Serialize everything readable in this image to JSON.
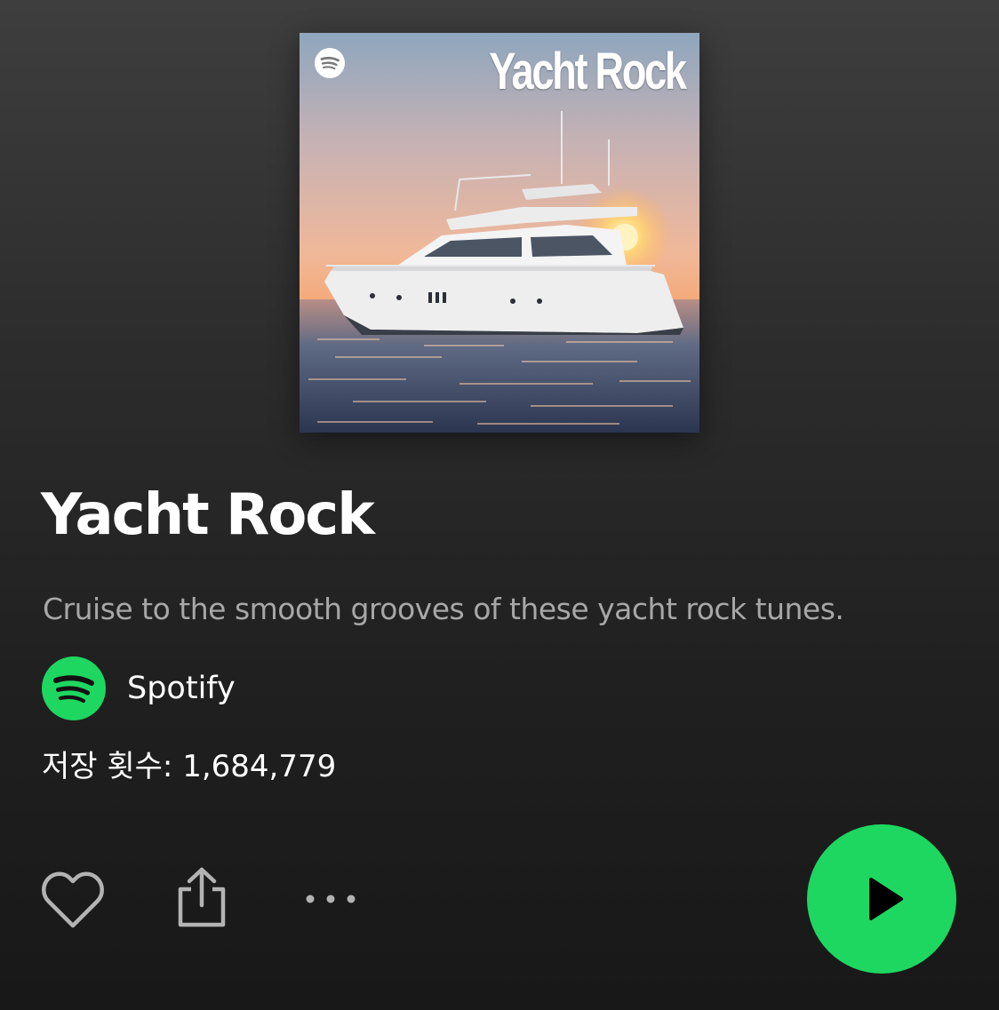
{
  "playlist": {
    "cover": {
      "overlay_title": "Yacht Rock",
      "brand_icon": "spotify-logo-icon",
      "image_subject": "yacht-at-sunset-photo"
    },
    "title": "Yacht Rock",
    "description": "Cruise to the smooth grooves of these yacht rock tunes.",
    "owner": {
      "name": "Spotify",
      "avatar_icon": "spotify-logo-icon",
      "avatar_color": "#1ed760"
    },
    "saves": "저장 횟수: 1,684,779"
  },
  "actions": {
    "like_icon": "heart-outline-icon",
    "share_icon": "share-icon",
    "more_icon": "ellipsis-icon",
    "play_icon": "play-icon",
    "play_button_color": "#1ed760"
  },
  "theme": {
    "background_top": "#3e3e3e",
    "background_bottom": "#181818",
    "text_primary": "#ffffff",
    "text_secondary": "#a7a7a7"
  }
}
